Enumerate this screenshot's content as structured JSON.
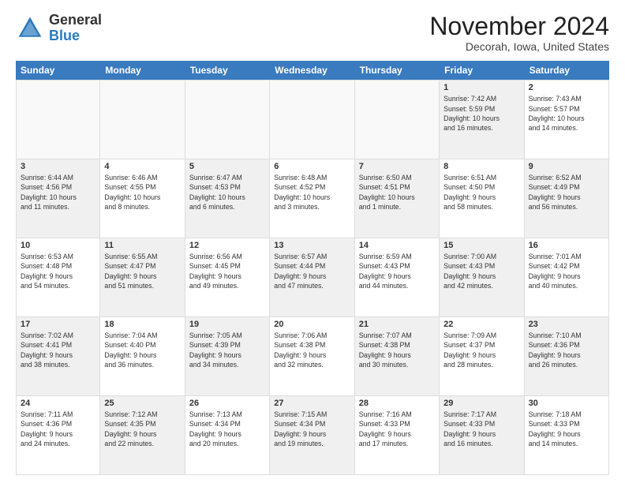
{
  "logo": {
    "general": "General",
    "blue": "Blue"
  },
  "title": "November 2024",
  "location": "Decorah, Iowa, United States",
  "days_of_week": [
    "Sunday",
    "Monday",
    "Tuesday",
    "Wednesday",
    "Thursday",
    "Friday",
    "Saturday"
  ],
  "rows": [
    {
      "cells": [
        {
          "day": "",
          "info": "",
          "empty": true
        },
        {
          "day": "",
          "info": "",
          "empty": true
        },
        {
          "day": "",
          "info": "",
          "empty": true
        },
        {
          "day": "",
          "info": "",
          "empty": true
        },
        {
          "day": "",
          "info": "",
          "empty": true
        },
        {
          "day": "1",
          "info": "Sunrise: 7:42 AM\nSunset: 5:59 PM\nDaylight: 10 hours\nand 16 minutes.",
          "shaded": true
        },
        {
          "day": "2",
          "info": "Sunrise: 7:43 AM\nSunset: 5:57 PM\nDaylight: 10 hours\nand 14 minutes."
        }
      ]
    },
    {
      "cells": [
        {
          "day": "3",
          "info": "Sunrise: 6:44 AM\nSunset: 4:56 PM\nDaylight: 10 hours\nand 11 minutes.",
          "shaded": true
        },
        {
          "day": "4",
          "info": "Sunrise: 6:46 AM\nSunset: 4:55 PM\nDaylight: 10 hours\nand 8 minutes."
        },
        {
          "day": "5",
          "info": "Sunrise: 6:47 AM\nSunset: 4:53 PM\nDaylight: 10 hours\nand 6 minutes.",
          "shaded": true
        },
        {
          "day": "6",
          "info": "Sunrise: 6:48 AM\nSunset: 4:52 PM\nDaylight: 10 hours\nand 3 minutes."
        },
        {
          "day": "7",
          "info": "Sunrise: 6:50 AM\nSunset: 4:51 PM\nDaylight: 10 hours\nand 1 minute.",
          "shaded": true
        },
        {
          "day": "8",
          "info": "Sunrise: 6:51 AM\nSunset: 4:50 PM\nDaylight: 9 hours\nand 58 minutes."
        },
        {
          "day": "9",
          "info": "Sunrise: 6:52 AM\nSunset: 4:49 PM\nDaylight: 9 hours\nand 56 minutes.",
          "shaded": true
        }
      ]
    },
    {
      "cells": [
        {
          "day": "10",
          "info": "Sunrise: 6:53 AM\nSunset: 4:48 PM\nDaylight: 9 hours\nand 54 minutes."
        },
        {
          "day": "11",
          "info": "Sunrise: 6:55 AM\nSunset: 4:47 PM\nDaylight: 9 hours\nand 51 minutes.",
          "shaded": true
        },
        {
          "day": "12",
          "info": "Sunrise: 6:56 AM\nSunset: 4:45 PM\nDaylight: 9 hours\nand 49 minutes."
        },
        {
          "day": "13",
          "info": "Sunrise: 6:57 AM\nSunset: 4:44 PM\nDaylight: 9 hours\nand 47 minutes.",
          "shaded": true
        },
        {
          "day": "14",
          "info": "Sunrise: 6:59 AM\nSunset: 4:43 PM\nDaylight: 9 hours\nand 44 minutes."
        },
        {
          "day": "15",
          "info": "Sunrise: 7:00 AM\nSunset: 4:43 PM\nDaylight: 9 hours\nand 42 minutes.",
          "shaded": true
        },
        {
          "day": "16",
          "info": "Sunrise: 7:01 AM\nSunset: 4:42 PM\nDaylight: 9 hours\nand 40 minutes."
        }
      ]
    },
    {
      "cells": [
        {
          "day": "17",
          "info": "Sunrise: 7:02 AM\nSunset: 4:41 PM\nDaylight: 9 hours\nand 38 minutes.",
          "shaded": true
        },
        {
          "day": "18",
          "info": "Sunrise: 7:04 AM\nSunset: 4:40 PM\nDaylight: 9 hours\nand 36 minutes."
        },
        {
          "day": "19",
          "info": "Sunrise: 7:05 AM\nSunset: 4:39 PM\nDaylight: 9 hours\nand 34 minutes.",
          "shaded": true
        },
        {
          "day": "20",
          "info": "Sunrise: 7:06 AM\nSunset: 4:38 PM\nDaylight: 9 hours\nand 32 minutes."
        },
        {
          "day": "21",
          "info": "Sunrise: 7:07 AM\nSunset: 4:38 PM\nDaylight: 9 hours\nand 30 minutes.",
          "shaded": true
        },
        {
          "day": "22",
          "info": "Sunrise: 7:09 AM\nSunset: 4:37 PM\nDaylight: 9 hours\nand 28 minutes."
        },
        {
          "day": "23",
          "info": "Sunrise: 7:10 AM\nSunset: 4:36 PM\nDaylight: 9 hours\nand 26 minutes.",
          "shaded": true
        }
      ]
    },
    {
      "cells": [
        {
          "day": "24",
          "info": "Sunrise: 7:11 AM\nSunset: 4:36 PM\nDaylight: 9 hours\nand 24 minutes."
        },
        {
          "day": "25",
          "info": "Sunrise: 7:12 AM\nSunset: 4:35 PM\nDaylight: 9 hours\nand 22 minutes.",
          "shaded": true
        },
        {
          "day": "26",
          "info": "Sunrise: 7:13 AM\nSunset: 4:34 PM\nDaylight: 9 hours\nand 20 minutes."
        },
        {
          "day": "27",
          "info": "Sunrise: 7:15 AM\nSunset: 4:34 PM\nDaylight: 9 hours\nand 19 minutes.",
          "shaded": true
        },
        {
          "day": "28",
          "info": "Sunrise: 7:16 AM\nSunset: 4:33 PM\nDaylight: 9 hours\nand 17 minutes."
        },
        {
          "day": "29",
          "info": "Sunrise: 7:17 AM\nSunset: 4:33 PM\nDaylight: 9 hours\nand 16 minutes.",
          "shaded": true
        },
        {
          "day": "30",
          "info": "Sunrise: 7:18 AM\nSunset: 4:33 PM\nDaylight: 9 hours\nand 14 minutes."
        }
      ]
    }
  ]
}
